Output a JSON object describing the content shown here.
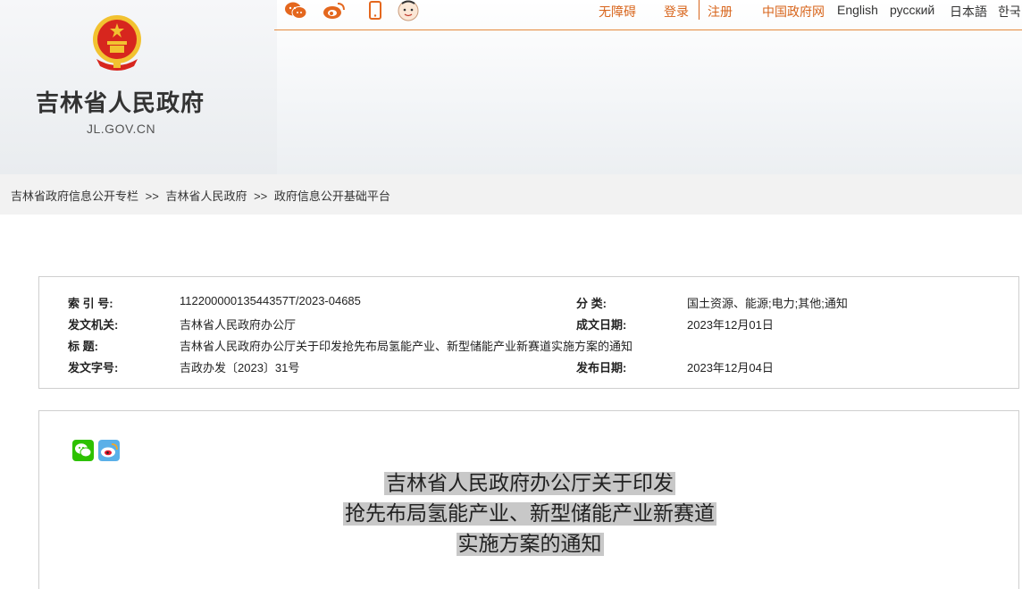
{
  "header": {
    "site_title": "吉林省人民政府",
    "site_domain": "JL.GOV.CN",
    "nav": {
      "accessibility": "无障碍",
      "login": "登录",
      "register": "注册",
      "gov_portal": "中国政府网",
      "english": "English",
      "russian": "русский",
      "japanese": "日本語",
      "korean": "한국"
    },
    "social_icons": [
      "wechat-icon",
      "weibo-icon",
      "mobile-icon",
      "mascot-icon"
    ]
  },
  "breadcrumb": {
    "items": [
      "吉林省政府信息公开专栏",
      "吉林省人民政府",
      "政府信息公开基础平台"
    ],
    "separator": ">>"
  },
  "meta": {
    "index_label": "索 引 号:",
    "index_value": "11220000013544357T/2023-04685",
    "category_label": "分     类:",
    "category_value": "国土资源、能源;电力;其他;通知",
    "issuer_label": "发文机关:",
    "issuer_value": "吉林省人民政府办公厅",
    "created_label": "成文日期:",
    "created_value": "2023年12月01日",
    "title_label": "标     题:",
    "title_value": "吉林省人民政府办公厅关于印发抢先布局氢能产业、新型储能产业新赛道实施方案的通知",
    "doc_no_label": "发文字号:",
    "doc_no_value": "吉政办发〔2023〕31号",
    "published_label": "发布日期:",
    "published_value": "2023年12月04日"
  },
  "article": {
    "title_lines": [
      "吉林省人民政府办公厅关于印发",
      "抢先布局氢能产业、新型储能产业新赛道",
      "实施方案的通知"
    ]
  },
  "colors": {
    "accent": "#d8651c",
    "emblem_red": "#d7261e",
    "emblem_gold": "#f2c230"
  }
}
